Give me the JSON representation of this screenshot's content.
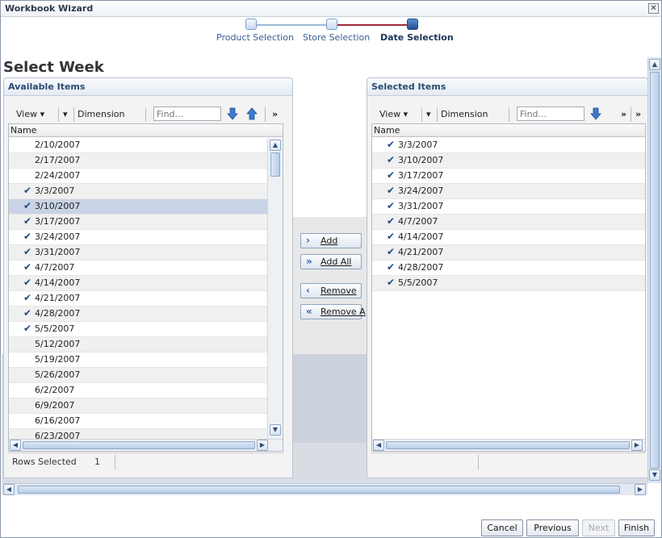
{
  "window": {
    "title": "Workbook Wizard",
    "close_glyph": "✕"
  },
  "train": {
    "steps": [
      {
        "label": "Product Selection",
        "state": "visited"
      },
      {
        "label": "Store Selection",
        "state": "visited"
      },
      {
        "label": "Date Selection",
        "state": "current"
      }
    ]
  },
  "page": {
    "title": "Select Week"
  },
  "available": {
    "title": "Available Items",
    "toolbar": {
      "view_label": "View",
      "dimension_label": "Dimension",
      "find_placeholder": "Find...",
      "more_glyph": "»"
    },
    "column_header": "Name",
    "rows": [
      {
        "label": "2/10/2007",
        "checked": false,
        "selected": false
      },
      {
        "label": "2/17/2007",
        "checked": false,
        "selected": false
      },
      {
        "label": "2/24/2007",
        "checked": false,
        "selected": false
      },
      {
        "label": "3/3/2007",
        "checked": true,
        "selected": false
      },
      {
        "label": "3/10/2007",
        "checked": true,
        "selected": true
      },
      {
        "label": "3/17/2007",
        "checked": true,
        "selected": false
      },
      {
        "label": "3/24/2007",
        "checked": true,
        "selected": false
      },
      {
        "label": "3/31/2007",
        "checked": true,
        "selected": false
      },
      {
        "label": "4/7/2007",
        "checked": true,
        "selected": false
      },
      {
        "label": "4/14/2007",
        "checked": true,
        "selected": false
      },
      {
        "label": "4/21/2007",
        "checked": true,
        "selected": false
      },
      {
        "label": "4/28/2007",
        "checked": true,
        "selected": false
      },
      {
        "label": "5/5/2007",
        "checked": true,
        "selected": false
      },
      {
        "label": "5/12/2007",
        "checked": false,
        "selected": false
      },
      {
        "label": "5/19/2007",
        "checked": false,
        "selected": false
      },
      {
        "label": "5/26/2007",
        "checked": false,
        "selected": false
      },
      {
        "label": "6/2/2007",
        "checked": false,
        "selected": false
      },
      {
        "label": "6/9/2007",
        "checked": false,
        "selected": false
      },
      {
        "label": "6/16/2007",
        "checked": false,
        "selected": false
      },
      {
        "label": "6/23/2007",
        "checked": false,
        "selected": false
      }
    ],
    "status": {
      "label": "Rows Selected",
      "value": "1"
    }
  },
  "selected": {
    "title": "Selected Items",
    "toolbar": {
      "view_label": "View",
      "dimension_label": "Dimension",
      "find_placeholder": "Find...",
      "more_glyph": "»"
    },
    "column_header": "Name",
    "rows": [
      {
        "label": "3/3/2007",
        "checked": true
      },
      {
        "label": "3/10/2007",
        "checked": true
      },
      {
        "label": "3/17/2007",
        "checked": true
      },
      {
        "label": "3/24/2007",
        "checked": true
      },
      {
        "label": "3/31/2007",
        "checked": true
      },
      {
        "label": "4/7/2007",
        "checked": true
      },
      {
        "label": "4/14/2007",
        "checked": true
      },
      {
        "label": "4/21/2007",
        "checked": true
      },
      {
        "label": "4/28/2007",
        "checked": true
      },
      {
        "label": "5/5/2007",
        "checked": true
      }
    ]
  },
  "shuttle": {
    "add": "Add",
    "add_all": "Add All",
    "remove": "Remove",
    "remove_all": "Remove A"
  },
  "footer": {
    "cancel": "Cancel",
    "previous": "Previous",
    "next": "Next",
    "finish": "Finish"
  },
  "colors": {
    "accent": "#2d64b2",
    "selected_row": "#c9d3e6",
    "check": "#1c4a85",
    "train_active_line": "#9c2a3a"
  }
}
